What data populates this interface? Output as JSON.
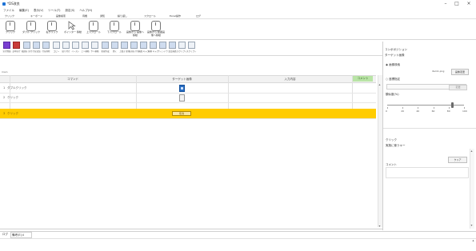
{
  "window": {
    "title": "*DS改良",
    "minimize": "–",
    "maximize": "□",
    "close": "×"
  },
  "menu": [
    "ファイル",
    "編集(E)",
    "表示(V)",
    "ツール(T)",
    "設定(S)",
    "ヘルプ(H)"
  ],
  "mode_tabs": [
    "クリック",
    "キーボード",
    "画像検索",
    "待機",
    "通知",
    "繰り返し",
    "スクロール",
    "Excel操作",
    "ログ"
  ],
  "toolbar": [
    {
      "label": "クリック",
      "icon": "mouse-click-icon"
    },
    {
      "label": "ダブル クリック",
      "icon": "mouse-double-click-icon"
    },
    {
      "label": "右クリック",
      "icon": "mouse-right-click-icon"
    },
    {
      "label": "ポインター 移動",
      "icon": "pointer-move-icon"
    },
    {
      "label": "上スクロール",
      "icon": "scroll-up-icon"
    },
    {
      "label": "下スクロール",
      "icon": "scroll-down-icon"
    },
    {
      "label": "画像から 画像へ移動",
      "icon": "image-to-image-icon"
    },
    {
      "label": "画像から 範囲画像へ移動",
      "icon": "image-range-icon"
    }
  ],
  "commands": [
    {
      "label": "実行開始",
      "style": "play"
    },
    {
      "label": "途中実行",
      "style": "play2"
    },
    {
      "label": "範囲を 実行",
      "style": "blue"
    },
    {
      "label": "行を追加",
      "style": "blue"
    },
    {
      "label": "行を削除",
      "style": "blue"
    },
    {
      "label": "コピー",
      "style": "plain"
    },
    {
      "label": "貼り付け",
      "style": "plain"
    },
    {
      "label": "ペースト",
      "style": "plain"
    },
    {
      "label": "上へ移動",
      "style": "plain"
    },
    {
      "label": "下へ移動",
      "style": "plain"
    },
    {
      "label": "新規作成",
      "style": "blue"
    },
    {
      "label": "開く",
      "style": "blue"
    },
    {
      "label": "上書き 保存",
      "style": "blue"
    },
    {
      "label": "名前を 付けて保存",
      "style": "blue"
    },
    {
      "label": "画面 キャプチャ",
      "style": "blue"
    },
    {
      "label": "画像 キャプチャ",
      "style": "blue"
    },
    {
      "label": "ウィンドウ",
      "style": "blue"
    },
    {
      "label": "設定画面",
      "style": "blue"
    },
    {
      "label": "スクリプト 記録",
      "style": "plain"
    },
    {
      "label": "スクリプト 停止",
      "style": "plain"
    }
  ],
  "sheet_tab": "main",
  "grid": {
    "headers": [
      "コマンド",
      "ターゲット画像",
      "入力内容",
      "コメント"
    ],
    "rows": [
      {
        "num": "1",
        "command": "ダブルクリック",
        "target": "image",
        "selected": false
      },
      {
        "num": "2",
        "command": "クリック",
        "target": "image",
        "selected": false
      },
      {
        "num": "3",
        "command": "クリック",
        "target": "button",
        "target_text": "取消",
        "selected": true
      }
    ]
  },
  "right_panel": {
    "section_title": "コンボポジション",
    "subtitle": "ターゲット画像",
    "radio_image_search": "画像検索",
    "file_name": "item1.png",
    "change_button": "画像変更",
    "radio_position": "座標指定",
    "position_button": "変更",
    "similarity_label": "類似度(%)",
    "slider_ticks": [
      "0",
      "20",
      "40",
      "60",
      "80",
      "100"
    ],
    "slider_value": 85,
    "click_title": "クリック",
    "click_sub": "実施に使うキー",
    "clear_button": "クリア",
    "comment_label": "コメント"
  },
  "bottom": {
    "tab_log": "ログ",
    "tab_note": "備考(E)メ"
  },
  "colors": {
    "selected_row": "#ffcc00",
    "comment_header": "#b9e4a6",
    "accent": "#1e73d6"
  }
}
